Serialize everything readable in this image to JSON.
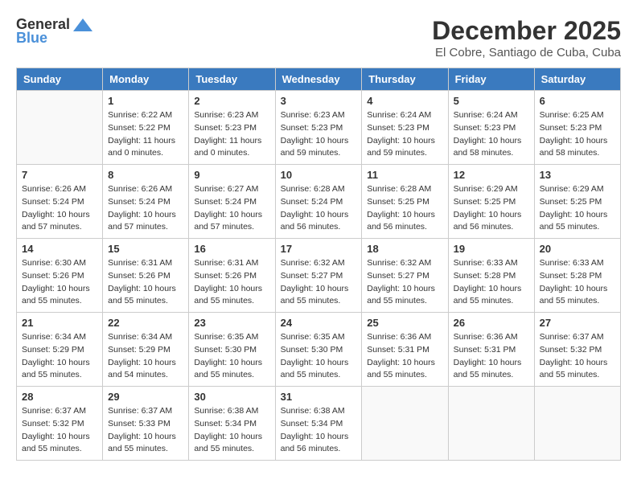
{
  "logo": {
    "general": "General",
    "blue": "Blue"
  },
  "title": "December 2025",
  "location": "El Cobre, Santiago de Cuba, Cuba",
  "weekdays": [
    "Sunday",
    "Monday",
    "Tuesday",
    "Wednesday",
    "Thursday",
    "Friday",
    "Saturday"
  ],
  "weeks": [
    [
      {
        "day": "",
        "info": ""
      },
      {
        "day": "1",
        "info": "Sunrise: 6:22 AM\nSunset: 5:22 PM\nDaylight: 11 hours\nand 0 minutes."
      },
      {
        "day": "2",
        "info": "Sunrise: 6:23 AM\nSunset: 5:23 PM\nDaylight: 11 hours\nand 0 minutes."
      },
      {
        "day": "3",
        "info": "Sunrise: 6:23 AM\nSunset: 5:23 PM\nDaylight: 10 hours\nand 59 minutes."
      },
      {
        "day": "4",
        "info": "Sunrise: 6:24 AM\nSunset: 5:23 PM\nDaylight: 10 hours\nand 59 minutes."
      },
      {
        "day": "5",
        "info": "Sunrise: 6:24 AM\nSunset: 5:23 PM\nDaylight: 10 hours\nand 58 minutes."
      },
      {
        "day": "6",
        "info": "Sunrise: 6:25 AM\nSunset: 5:23 PM\nDaylight: 10 hours\nand 58 minutes."
      }
    ],
    [
      {
        "day": "7",
        "info": "Sunrise: 6:26 AM\nSunset: 5:24 PM\nDaylight: 10 hours\nand 57 minutes."
      },
      {
        "day": "8",
        "info": "Sunrise: 6:26 AM\nSunset: 5:24 PM\nDaylight: 10 hours\nand 57 minutes."
      },
      {
        "day": "9",
        "info": "Sunrise: 6:27 AM\nSunset: 5:24 PM\nDaylight: 10 hours\nand 57 minutes."
      },
      {
        "day": "10",
        "info": "Sunrise: 6:28 AM\nSunset: 5:24 PM\nDaylight: 10 hours\nand 56 minutes."
      },
      {
        "day": "11",
        "info": "Sunrise: 6:28 AM\nSunset: 5:25 PM\nDaylight: 10 hours\nand 56 minutes."
      },
      {
        "day": "12",
        "info": "Sunrise: 6:29 AM\nSunset: 5:25 PM\nDaylight: 10 hours\nand 56 minutes."
      },
      {
        "day": "13",
        "info": "Sunrise: 6:29 AM\nSunset: 5:25 PM\nDaylight: 10 hours\nand 55 minutes."
      }
    ],
    [
      {
        "day": "14",
        "info": "Sunrise: 6:30 AM\nSunset: 5:26 PM\nDaylight: 10 hours\nand 55 minutes."
      },
      {
        "day": "15",
        "info": "Sunrise: 6:31 AM\nSunset: 5:26 PM\nDaylight: 10 hours\nand 55 minutes."
      },
      {
        "day": "16",
        "info": "Sunrise: 6:31 AM\nSunset: 5:26 PM\nDaylight: 10 hours\nand 55 minutes."
      },
      {
        "day": "17",
        "info": "Sunrise: 6:32 AM\nSunset: 5:27 PM\nDaylight: 10 hours\nand 55 minutes."
      },
      {
        "day": "18",
        "info": "Sunrise: 6:32 AM\nSunset: 5:27 PM\nDaylight: 10 hours\nand 55 minutes."
      },
      {
        "day": "19",
        "info": "Sunrise: 6:33 AM\nSunset: 5:28 PM\nDaylight: 10 hours\nand 55 minutes."
      },
      {
        "day": "20",
        "info": "Sunrise: 6:33 AM\nSunset: 5:28 PM\nDaylight: 10 hours\nand 55 minutes."
      }
    ],
    [
      {
        "day": "21",
        "info": "Sunrise: 6:34 AM\nSunset: 5:29 PM\nDaylight: 10 hours\nand 55 minutes."
      },
      {
        "day": "22",
        "info": "Sunrise: 6:34 AM\nSunset: 5:29 PM\nDaylight: 10 hours\nand 54 minutes."
      },
      {
        "day": "23",
        "info": "Sunrise: 6:35 AM\nSunset: 5:30 PM\nDaylight: 10 hours\nand 55 minutes."
      },
      {
        "day": "24",
        "info": "Sunrise: 6:35 AM\nSunset: 5:30 PM\nDaylight: 10 hours\nand 55 minutes."
      },
      {
        "day": "25",
        "info": "Sunrise: 6:36 AM\nSunset: 5:31 PM\nDaylight: 10 hours\nand 55 minutes."
      },
      {
        "day": "26",
        "info": "Sunrise: 6:36 AM\nSunset: 5:31 PM\nDaylight: 10 hours\nand 55 minutes."
      },
      {
        "day": "27",
        "info": "Sunrise: 6:37 AM\nSunset: 5:32 PM\nDaylight: 10 hours\nand 55 minutes."
      }
    ],
    [
      {
        "day": "28",
        "info": "Sunrise: 6:37 AM\nSunset: 5:32 PM\nDaylight: 10 hours\nand 55 minutes."
      },
      {
        "day": "29",
        "info": "Sunrise: 6:37 AM\nSunset: 5:33 PM\nDaylight: 10 hours\nand 55 minutes."
      },
      {
        "day": "30",
        "info": "Sunrise: 6:38 AM\nSunset: 5:34 PM\nDaylight: 10 hours\nand 55 minutes."
      },
      {
        "day": "31",
        "info": "Sunrise: 6:38 AM\nSunset: 5:34 PM\nDaylight: 10 hours\nand 56 minutes."
      },
      {
        "day": "",
        "info": ""
      },
      {
        "day": "",
        "info": ""
      },
      {
        "day": "",
        "info": ""
      }
    ]
  ]
}
